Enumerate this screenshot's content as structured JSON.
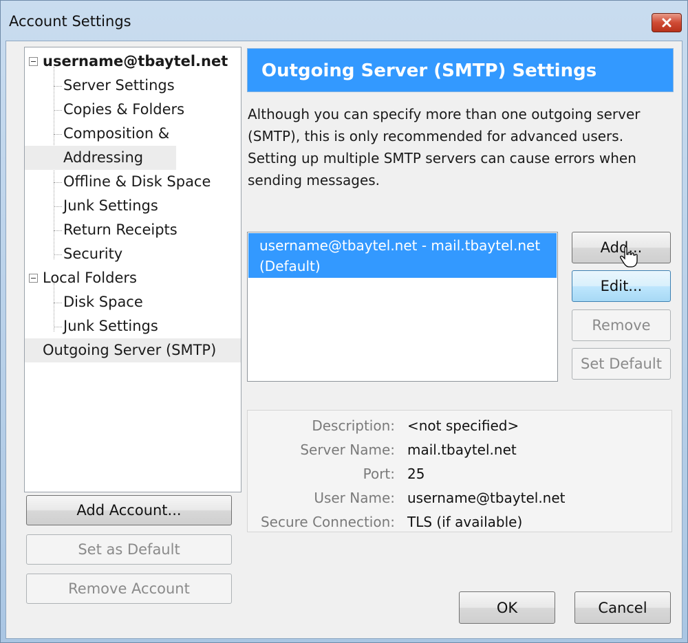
{
  "window": {
    "title": "Account Settings",
    "close_icon": "close-icon"
  },
  "tree": {
    "account": "username@tbaytel.net",
    "account_children": [
      "Server Settings",
      "Copies & Folders",
      "Composition &",
      "Addressing",
      "Offline & Disk Space",
      "Junk Settings",
      "Return Receipts",
      "Security"
    ],
    "local_folders": "Local Folders",
    "local_children": [
      "Disk Space",
      "Junk Settings"
    ],
    "outgoing": "Outgoing Server (SMTP)"
  },
  "left_buttons": {
    "add_account": "Add Account...",
    "set_default": "Set as Default",
    "remove_account": "Remove Account"
  },
  "panel": {
    "title": "Outgoing Server (SMTP) Settings",
    "description": "Although you can specify more than one outgoing server (SMTP), this is only recommended for advanced users. Setting up multiple SMTP servers can cause errors when sending messages.",
    "server_line1": "username@tbaytel.net - mail.tbaytel.net",
    "server_line2": "(Default)"
  },
  "server_buttons": {
    "add": "Add...",
    "edit": "Edit...",
    "remove": "Remove",
    "set_default": "Set Default"
  },
  "details": {
    "description_label": "Description:",
    "description_value": "<not specified>",
    "server_name_label": "Server Name:",
    "server_name_value": "mail.tbaytel.net",
    "port_label": "Port:",
    "port_value": "25",
    "user_name_label": "User Name:",
    "user_name_value": "username@tbaytel.net",
    "secure_label": "Secure Connection:",
    "secure_value": "TLS (if available)"
  },
  "footer": {
    "ok": "OK",
    "cancel": "Cancel"
  },
  "colors": {
    "accent": "#3399ff",
    "close": "#c7432c"
  }
}
